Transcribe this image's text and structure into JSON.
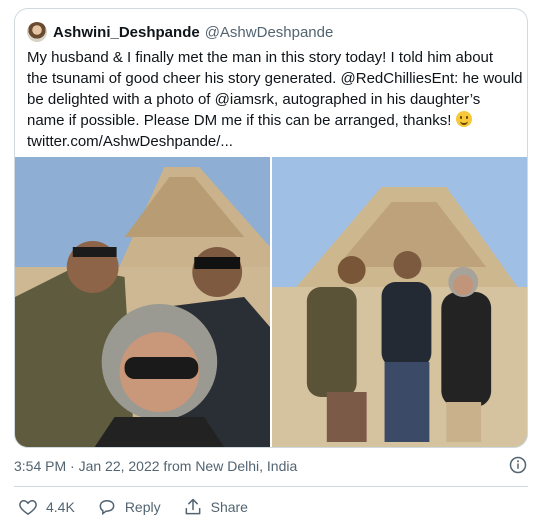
{
  "tweet": {
    "display_name": "Ashwini_Deshpande",
    "handle": "@AshwDeshpande",
    "text_lines": [
      "My husband & I finally met the man in this story today! I told him about",
      "the tsunami of good cheer his story generated. @RedChilliesEnt: he would",
      "be delighted with a photo of @iamsrk, autographed in his daughter’s",
      "name if possible. Please DM me if this can be arranged, thanks!",
      "twitter.com/AshwDeshpande/..."
    ],
    "timestamp_line": "3:54 PM · Jan 22, 2022 from New Delhi, India"
  },
  "actions": {
    "like_count": "4.4K",
    "reply_label": "Reply",
    "share_label": "Share"
  },
  "icons": [
    "heart-icon",
    "reply-icon",
    "share-icon",
    "info-icon",
    "smiling-emoji"
  ],
  "colors": {
    "secondary_text": "#536471",
    "border": "#cfd9de"
  }
}
